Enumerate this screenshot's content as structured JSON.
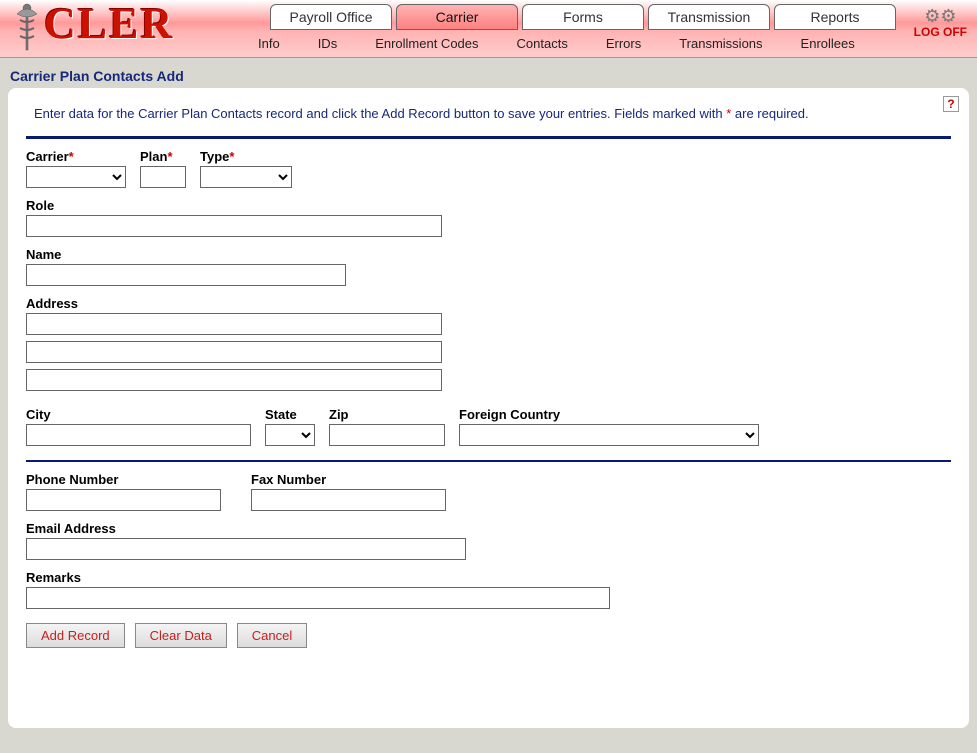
{
  "app": {
    "logo": "CLER",
    "logoff": "LOG OFF"
  },
  "tabs": {
    "items": [
      {
        "label": "Payroll Office"
      },
      {
        "label": "Carrier"
      },
      {
        "label": "Forms"
      },
      {
        "label": "Transmission"
      },
      {
        "label": "Reports"
      }
    ],
    "active_index": 1
  },
  "subtabs": {
    "items": [
      {
        "label": "Info"
      },
      {
        "label": "IDs"
      },
      {
        "label": "Enrollment Codes"
      },
      {
        "label": "Contacts"
      },
      {
        "label": "Errors"
      },
      {
        "label": "Transmissions"
      },
      {
        "label": "Enrollees"
      }
    ]
  },
  "page": {
    "title": "Carrier Plan Contacts Add",
    "instructions_pre": "Enter data for the Carrier Plan Contacts record and click the Add Record button to save your entries.  Fields marked with ",
    "instructions_star": "*",
    "instructions_post": " are required.",
    "help": "?"
  },
  "fields": {
    "carrier": {
      "label": "Carrier",
      "required": true,
      "value": ""
    },
    "plan": {
      "label": "Plan",
      "required": true,
      "value": ""
    },
    "type": {
      "label": "Type",
      "required": true,
      "value": ""
    },
    "role": {
      "label": "Role",
      "value": ""
    },
    "name": {
      "label": "Name",
      "value": ""
    },
    "address": {
      "label": "Address",
      "line1": "",
      "line2": "",
      "line3": ""
    },
    "city": {
      "label": "City",
      "value": ""
    },
    "state": {
      "label": "State",
      "value": ""
    },
    "zip": {
      "label": "Zip",
      "value": ""
    },
    "foreign_country": {
      "label": "Foreign Country",
      "value": ""
    },
    "phone": {
      "label": "Phone Number",
      "value": ""
    },
    "fax": {
      "label": "Fax Number",
      "value": ""
    },
    "email": {
      "label": "Email Address",
      "value": ""
    },
    "remarks": {
      "label": "Remarks",
      "value": ""
    }
  },
  "buttons": {
    "add": "Add Record",
    "clear": "Clear Data",
    "cancel": "Cancel"
  }
}
